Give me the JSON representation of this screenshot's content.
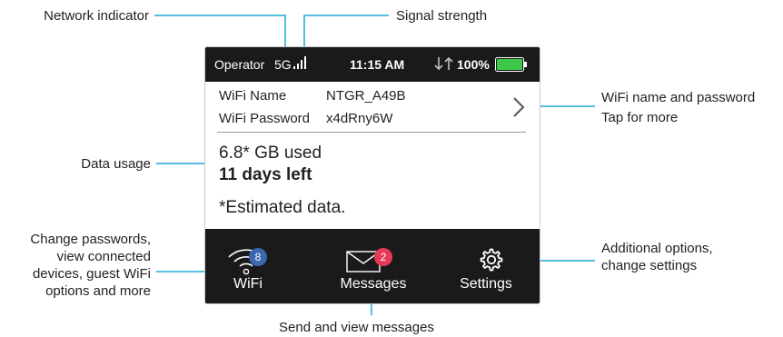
{
  "callouts": {
    "network_indicator": "Network indicator",
    "signal_strength": "Signal strength",
    "wifi_name_password_1": "WiFi name and password",
    "wifi_name_password_2": "Tap for more",
    "data_usage": "Data usage",
    "change_passwords": [
      "Change passwords,",
      "view connected",
      "devices, guest WiFi",
      "options and more"
    ],
    "additional_options": [
      "Additional options,",
      "change settings"
    ],
    "send_messages": "Send and view messages"
  },
  "status_bar": {
    "operator": "Operator",
    "network": "5G",
    "time": "11:15 AM",
    "battery_percent": "100%",
    "signal_icon": "signal-bars-icon",
    "transfer_icon": "up-down-arrows-icon",
    "battery_icon": "battery-icon",
    "battery_level": 1.0
  },
  "wifi": {
    "name_label": "WiFi Name",
    "name_value": "NTGR_A49B",
    "password_label": "WiFi Password",
    "password_value": "x4dRny6W"
  },
  "usage": {
    "used": "6.8* GB used",
    "days_left": "11 days left",
    "note": "*Estimated data."
  },
  "nav": {
    "wifi_label": "WiFi",
    "wifi_badge": "8",
    "messages_label": "Messages",
    "messages_badge": "2",
    "settings_label": "Settings"
  },
  "colors": {
    "leader_line": "#55bfe0",
    "status_bar_bg": "#1a1a1a",
    "battery_fill": "#3cc64a",
    "wifi_badge": "#3a67b0",
    "messages_badge": "#e63a57"
  }
}
